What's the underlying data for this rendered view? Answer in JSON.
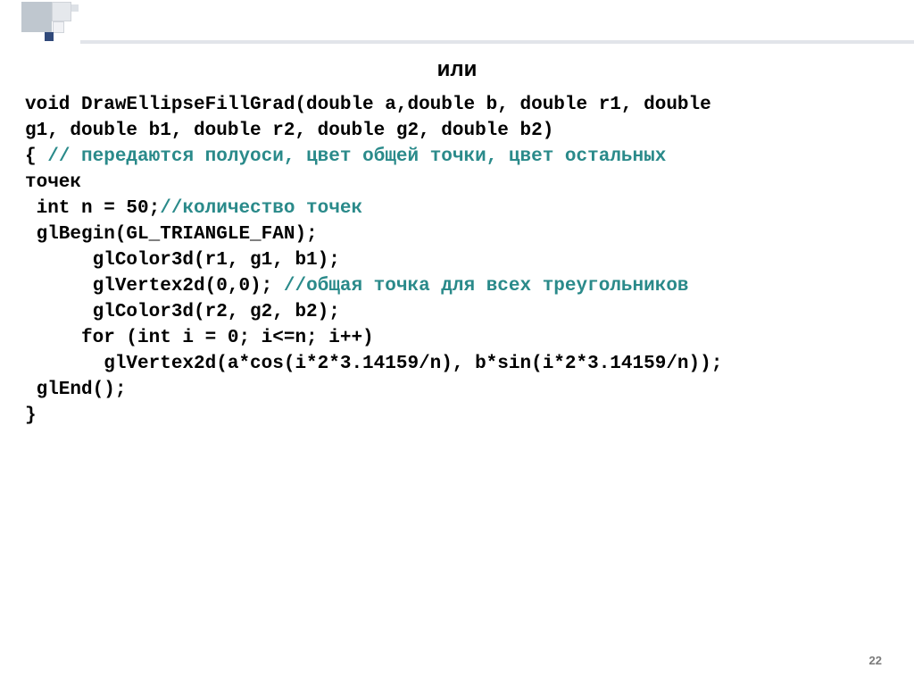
{
  "title": "или",
  "page_number": "22",
  "code": {
    "sig1": "void DrawEllipseFillGrad(double a,double b, double r1, double",
    "sig2": "g1, double b1, double r2, double g2, double b2)",
    "brace_open": "{ ",
    "comment1": "// передаются полуоси, цвет общей точки, цвет остальных",
    "comment1b": "точек",
    "l_n_decl": " int n = 50;",
    "comment2": "//количество точек",
    "l_begin": " glBegin(GL_TRIANGLE_FAN);",
    "l_color1": "      glColor3d(r1, g1, b1);",
    "l_vertex0": "      glVertex2d(0,0); ",
    "comment3": "//общая точка для всех треугольников",
    "l_color2": "      glColor3d(r2, g2, b2);",
    "l_for": "     for (int i = 0; i<=n; i++)",
    "l_vertex_loop": "       glVertex2d(a*cos(i*2*3.14159/n), b*sin(i*2*3.14159/n));",
    "l_end": " glEnd();",
    "brace_close": "}"
  }
}
